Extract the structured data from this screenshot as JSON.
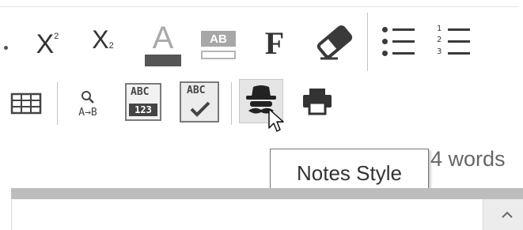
{
  "toolbar_row1": {
    "superscript": {
      "base": "X",
      "mark": "2",
      "icon": "superscript-icon"
    },
    "subscript": {
      "base": "X",
      "mark": "2",
      "icon": "subscript-icon"
    },
    "font_color": {
      "letter": "A",
      "icon": "font-color-icon",
      "bar_color": "#555555"
    },
    "highlight": {
      "letters": "AB",
      "icon": "highlight-icon"
    },
    "font": {
      "letter": "F",
      "icon": "font-icon"
    },
    "clear_format": {
      "icon": "eraser-icon"
    },
    "bullet_list": {
      "icon": "bulleted-list-icon"
    },
    "numbered_list": {
      "icon": "numbered-list-icon",
      "numbers": [
        "1",
        "2",
        "3"
      ]
    }
  },
  "toolbar_row2": {
    "table": {
      "icon": "table-icon"
    },
    "find_replace": {
      "icon": "find-replace-icon",
      "label": "A→B"
    },
    "spell_numbers": {
      "icon": "spellcheck-numbers-icon",
      "top": "ABC",
      "bottom": "123"
    },
    "spell_check": {
      "icon": "spellcheck-icon",
      "top": "ABC"
    },
    "notes_style": {
      "icon": "incognito-icon",
      "active": true
    },
    "print": {
      "icon": "printer-icon"
    }
  },
  "tooltip": {
    "text": "Notes Style"
  },
  "status": {
    "word_count": "4 words"
  },
  "scrollbar": {
    "up_icon": "chevron-up-icon"
  },
  "colors": {
    "icon": "#333333",
    "greybar": "#bdbdbd",
    "active_bg": "#e5e5e5"
  }
}
